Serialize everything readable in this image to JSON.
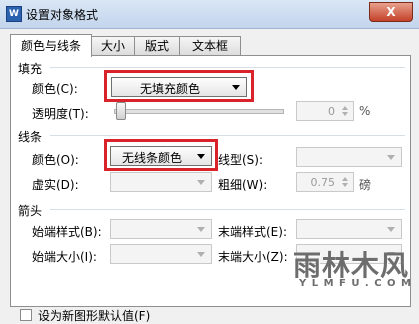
{
  "window": {
    "title": "设置对象格式",
    "close_label": "X"
  },
  "tabs": [
    {
      "label": "颜色与线条",
      "active": true
    },
    {
      "label": "大小"
    },
    {
      "label": "版式"
    },
    {
      "label": "文本框"
    }
  ],
  "fill": {
    "section": "填充",
    "color_label": "颜色(C):",
    "color_value": "无填充颜色",
    "transparency_label": "透明度(T):",
    "transparency_value": "0",
    "transparency_unit": "%",
    "transparency_level": 0
  },
  "line": {
    "section": "线条",
    "color_label": "颜色(O):",
    "color_value": "无线条颜色",
    "style_label": "线型(S):",
    "dash_label": "虚实(D):",
    "weight_label": "粗细(W):",
    "weight_value": "0.75",
    "weight_unit": "磅"
  },
  "arrows": {
    "section": "箭头",
    "begin_style_label": "始端样式(B):",
    "end_style_label": "末端样式(E):",
    "begin_size_label": "始端大小(I):",
    "end_size_label": "末端大小(Z):"
  },
  "default_checkbox": {
    "label": "设为新图形默认值(F)",
    "checked": false
  },
  "watermark": {
    "main": "雨林木风",
    "sub": "Y L M F U . C O M"
  },
  "colors": {
    "highlight": "#d8232a"
  }
}
